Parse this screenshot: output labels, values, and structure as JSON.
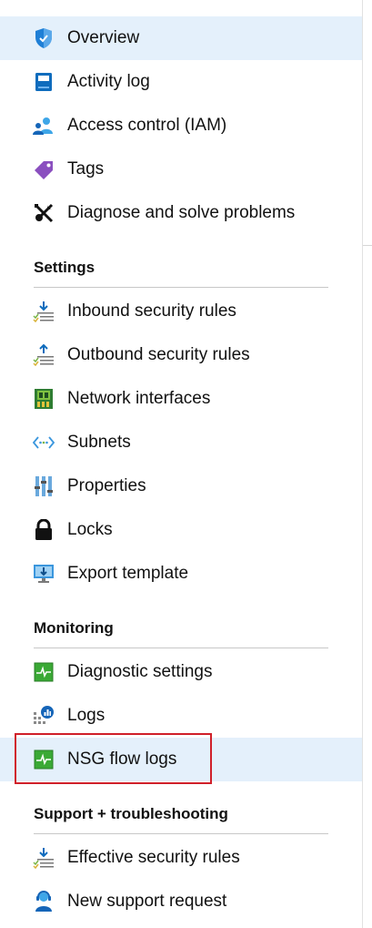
{
  "nav": {
    "items": [
      {
        "id": "overview",
        "label": "Overview",
        "icon": "shield-icon",
        "selected": true
      },
      {
        "id": "activity-log",
        "label": "Activity log",
        "icon": "book-icon"
      },
      {
        "id": "access-control",
        "label": "Access control (IAM)",
        "icon": "people-icon"
      },
      {
        "id": "tags",
        "label": "Tags",
        "icon": "tag-icon"
      },
      {
        "id": "diagnose",
        "label": "Diagnose and solve problems",
        "icon": "wrench-icon"
      }
    ],
    "sections": [
      {
        "title": "Settings",
        "items": [
          {
            "id": "inbound-rules",
            "label": "Inbound security rules",
            "icon": "inbound-rules-icon"
          },
          {
            "id": "outbound-rules",
            "label": "Outbound security rules",
            "icon": "outbound-rules-icon"
          },
          {
            "id": "network-interfaces",
            "label": "Network interfaces",
            "icon": "network-card-icon"
          },
          {
            "id": "subnets",
            "label": "Subnets",
            "icon": "subnet-icon"
          },
          {
            "id": "properties",
            "label": "Properties",
            "icon": "sliders-icon"
          },
          {
            "id": "locks",
            "label": "Locks",
            "icon": "lock-icon"
          },
          {
            "id": "export-template",
            "label": "Export template",
            "icon": "monitor-download-icon"
          }
        ]
      },
      {
        "title": "Monitoring",
        "items": [
          {
            "id": "diagnostic-settings",
            "label": "Diagnostic settings",
            "icon": "pulse-icon"
          },
          {
            "id": "logs",
            "label": "Logs",
            "icon": "logs-icon"
          },
          {
            "id": "nsg-flow-logs",
            "label": "NSG flow logs",
            "icon": "pulse-icon",
            "highlighted": true
          }
        ]
      },
      {
        "title": "Support + troubleshooting",
        "items": [
          {
            "id": "effective-rules",
            "label": "Effective security rules",
            "icon": "inbound-rules-icon"
          },
          {
            "id": "support-request",
            "label": "New support request",
            "icon": "support-person-icon"
          }
        ]
      }
    ]
  },
  "colors": {
    "selected_bg": "#e4f0fb",
    "highlight_border": "#d0202a",
    "azure_blue": "#0078d4",
    "green": "#3aa935"
  }
}
